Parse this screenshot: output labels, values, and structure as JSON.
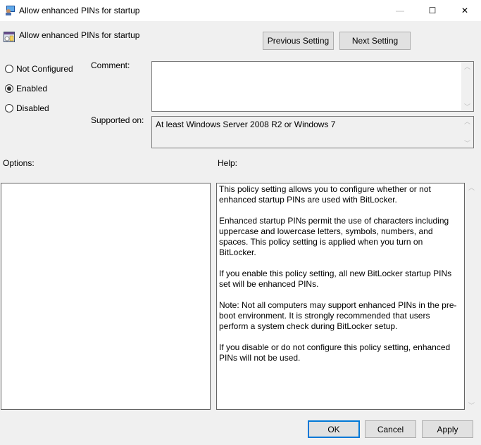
{
  "window": {
    "title": "Allow enhanced PINs for startup",
    "controls": {
      "minimize": "—",
      "maximize": "☐",
      "close": "✕"
    }
  },
  "header": {
    "setting_name": "Allow enhanced PINs for startup",
    "previous_label": "Previous Setting",
    "next_label": "Next Setting"
  },
  "state": {
    "options": [
      {
        "label": "Not Configured",
        "checked": false
      },
      {
        "label": "Enabled",
        "checked": true
      },
      {
        "label": "Disabled",
        "checked": false
      }
    ]
  },
  "comment": {
    "label": "Comment:",
    "value": ""
  },
  "supported": {
    "label": "Supported on:",
    "value": "At least Windows Server 2008 R2 or Windows 7"
  },
  "options_label": "Options:",
  "help": {
    "label": "Help:",
    "paragraphs": [
      "This policy setting allows you to configure whether or not enhanced startup PINs are used with BitLocker.",
      "Enhanced startup PINs permit the use of characters including uppercase and lowercase letters, symbols, numbers, and spaces. This policy setting is applied when you turn on BitLocker.",
      "If you enable this policy setting, all new BitLocker startup PINs set will be enhanced PINs.",
      "Note:   Not all computers may support enhanced PINs in the pre-boot environment. It is strongly recommended that users perform a system check during BitLocker setup.",
      "If you disable or do not configure this policy setting, enhanced PINs will not be used."
    ]
  },
  "footer": {
    "ok_label": "OK",
    "cancel_label": "Cancel",
    "apply_label": "Apply"
  },
  "colors": {
    "accent": "#0078d7",
    "background": "#f0f0f0"
  }
}
